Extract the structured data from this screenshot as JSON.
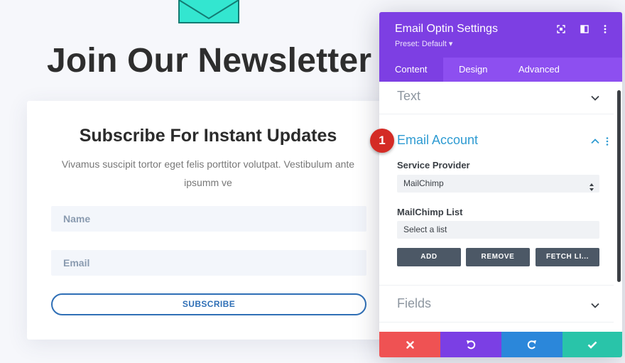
{
  "page": {
    "heading": "Join Our Newsletter",
    "optin": {
      "title": "Subscribe For Instant Updates",
      "description": "Vivamus suscipit tortor eget felis porttitor volutpat. Vestibulum ante ipsumm ve",
      "name_placeholder": "Name",
      "email_placeholder": "Email",
      "subscribe_label": "SUBSCRIBE"
    },
    "icons": {
      "envelope": "envelope-icon"
    }
  },
  "modal": {
    "title": "Email Optin Settings",
    "preset": "Preset: Default ▾",
    "header_icons": [
      "focus-icon",
      "split-layout-icon",
      "more-vertical-icon"
    ],
    "tabs": [
      {
        "label": "Content",
        "active": true
      },
      {
        "label": "Design",
        "active": false
      },
      {
        "label": "Advanced",
        "active": false
      }
    ],
    "sections": {
      "text": {
        "title": "Text",
        "state": "collapsed"
      },
      "email_account": {
        "title": "Email Account",
        "state": "expanded",
        "step_badge": "1",
        "service_provider_label": "Service Provider",
        "service_provider_value": "MailChimp",
        "list_label": "MailChimp List",
        "list_value": "Select a list",
        "buttons": {
          "add": "ADD",
          "remove": "REMOVE",
          "fetch": "FETCH LI..."
        }
      },
      "fields": {
        "title": "Fields",
        "state": "collapsed"
      }
    },
    "footer": {
      "cancel": "close-icon",
      "undo": "undo-icon",
      "redo": "redo-icon",
      "save": "check-icon"
    }
  },
  "colors": {
    "purple_header": "#7d3fe3",
    "purple_tabs": "#8d4ff0",
    "teal_icon": "#2ee8d2",
    "blue_accent": "#2e9bd2",
    "badge_red": "#d42b25",
    "btn_dark": "#4c5866",
    "footer_red": "#ef5253",
    "footer_purple": "#7b3fe4",
    "footer_blue": "#2b87da",
    "footer_green": "#29c4a9"
  }
}
